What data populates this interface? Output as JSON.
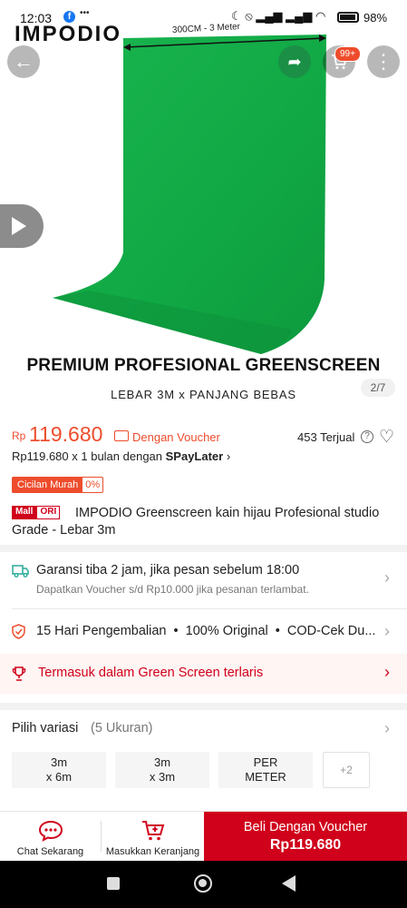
{
  "status_bar": {
    "time": "12:03",
    "facebook_letter": "f",
    "sim_icon": "sim-card-icon",
    "more_dots": "•••",
    "right_icons": "☾ ⦸ ▂▄▆ ▂▄▆ ◠",
    "battery_percent": "98%"
  },
  "hero": {
    "brand": "IMPODIO",
    "dimension_label": "300CM - 3 Meter",
    "cart_badge": "99+",
    "promo_title": "PREMIUM PROFESIONAL GREENSCREEN",
    "promo_subtitle": "LEBAR 3M x PANJANG BEBAS",
    "pager": "2/7",
    "backdrop_color": "#15b24a"
  },
  "icons": {
    "back": "←",
    "share": "➦",
    "more": "⋮",
    "help": "?",
    "heart": "♡",
    "chevron": "›"
  },
  "price": {
    "currency": "Rp",
    "amount": "119.680",
    "voucher_label": "Dengan Voucher",
    "sold": "453 Terjual",
    "installment_prefix": "Rp119.680 x 1 bulan dengan ",
    "installment_brand": "SPayLater",
    "installment_chevron": "›",
    "cicilan_label": "Cicilan Murah",
    "cicilan_rate": "0%"
  },
  "product": {
    "mall_label": "Mall",
    "ori_label": "ORI",
    "title": "IMPODIO Greenscreen kain hijau Profesional studio Grade - Lebar 3m"
  },
  "shipping": {
    "title": "Garansi tiba 2 jam, jika pesan sebelum 18:00",
    "subtitle": "Dapatkan Voucher s/d Rp10.000 jika pesanan terlambat."
  },
  "guarantee": {
    "text": "15 Hari Pengembalian  •  100% Original  •  COD-Cek Du..."
  },
  "best_seller": {
    "text": "Termasuk dalam Green Screen terlaris"
  },
  "variations": {
    "label": "Pilih variasi",
    "count": "(5 Ukuran)",
    "options": [
      {
        "line1": "3m",
        "line2": "x 6m"
      },
      {
        "line1": "3m",
        "line2": "x 3m"
      },
      {
        "line1": "PER",
        "line2": "METER"
      }
    ],
    "more": "+2"
  },
  "bottom_bar": {
    "chat_label": "Chat Sekarang",
    "cart_label": "Masukkan Keranjang",
    "buy_line1": "Beli Dengan Voucher",
    "buy_line2": "Rp119.680"
  },
  "colors": {
    "accent": "#ee4d2d",
    "buy_button": "#d0011b",
    "green": "#15b24a"
  }
}
